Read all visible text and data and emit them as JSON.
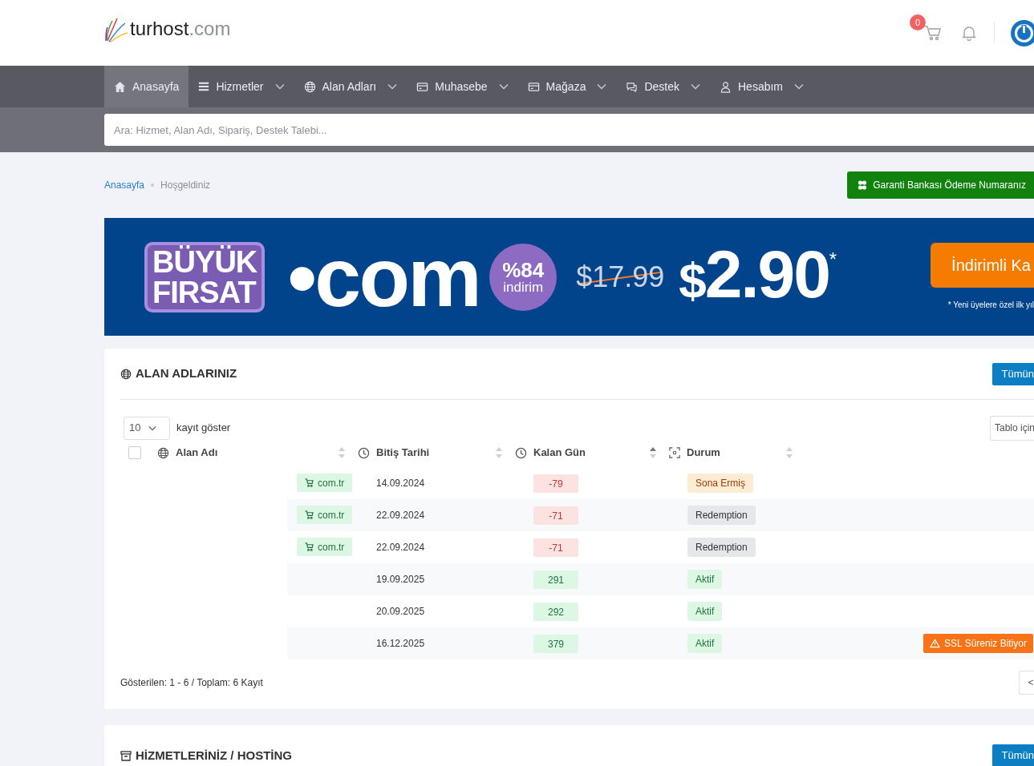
{
  "header": {
    "logo": {
      "brand": "turhost",
      "tld": ".com"
    },
    "cart_count": "0"
  },
  "nav": [
    {
      "label": "Anasayfa",
      "selected": true,
      "dropdown": false
    },
    {
      "label": "Hizmetler",
      "selected": false,
      "dropdown": true
    },
    {
      "label": "Alan Adları",
      "selected": false,
      "dropdown": true
    },
    {
      "label": "Muhasebe",
      "selected": false,
      "dropdown": true
    },
    {
      "label": "Mağaza",
      "selected": false,
      "dropdown": true
    },
    {
      "label": "Destek",
      "selected": false,
      "dropdown": true
    },
    {
      "label": "Hesabım",
      "selected": false,
      "dropdown": true
    }
  ],
  "search": {
    "placeholder": "Ara: Hizmet, Alan Adı, Sipariş, Destek Talebi..."
  },
  "breadcrumb": [
    {
      "label": "Anasayfa",
      "selected": false
    },
    {
      "label": "Hoşgeldiniz",
      "selected": true
    }
  ],
  "payment_button": "Garanti Bankası Ödeme Numaranız",
  "banner": {
    "badge_line_1": "BÜYÜK",
    "badge_line_2": "FIRSAT",
    "domain": "•com",
    "discount": "%84",
    "discount_label": "indirim",
    "old_price": "$17.99",
    "currency": "$",
    "price": "2.90",
    "asterisk": "*",
    "cta": "İndirimli Ka",
    "footnote": "* Yeni üyelere özel ilk yıl"
  },
  "domains_card": {
    "title": "ALAN ADLARINIZ",
    "all_button": "Tümün",
    "page_size": "10",
    "page_size_label": "kayıt göster",
    "table_search_placeholder": "Tablo için",
    "columns": [
      {
        "label": "Alan Adı",
        "sorted": false
      },
      {
        "label": "Bitiş Tarihi",
        "sorted": false
      },
      {
        "label": "Kalan Gün",
        "sorted": true
      },
      {
        "label": "Durum",
        "sorted": false
      }
    ],
    "select_all_checked": false,
    "rows": [
      {
        "kind": "expired",
        "tag": "com.tr",
        "expiry": "14.09.2024",
        "days_left": "-79",
        "status": "Sona Ermiş"
      },
      {
        "kind": "redemption",
        "tag": "com.tr",
        "expiry": "22.09.2024",
        "days_left": "-71",
        "status": "Redemption"
      },
      {
        "kind": "redemption",
        "tag": "com.tr",
        "expiry": "22.09.2024",
        "days_left": "-71",
        "status": "Redemption"
      },
      {
        "kind": "active",
        "expiry": "19.09.2025",
        "days_left": "291",
        "status": "Aktif"
      },
      {
        "kind": "active",
        "expiry": "20.09.2025",
        "days_left": "292",
        "status": "Aktif"
      },
      {
        "kind": "active",
        "expiry": "16.12.2025",
        "days_left": "379",
        "status": "Aktif",
        "warning": "SSL Süreniz Bitiyor"
      }
    ],
    "summary": "Gösterilen: 1 - 6 / Toplam: 6 Kayıt",
    "pager": "<"
  },
  "services_card": {
    "title": "HİZMETLERİNİZ / HOSTİNG",
    "all_button": "Tümün"
  }
}
